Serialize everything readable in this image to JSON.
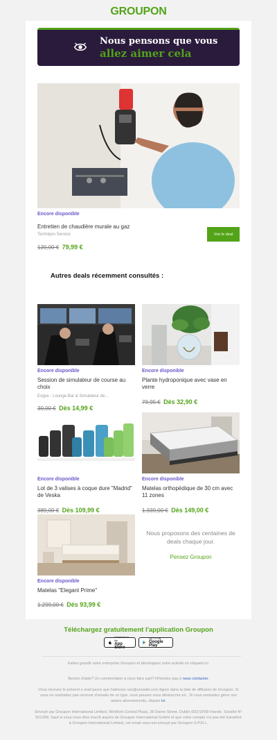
{
  "brand": {
    "logo": "GROUPON",
    "accent": "#53a318",
    "purple": "#2a1b3d",
    "available": "#6b55c9"
  },
  "hero": {
    "line1": "Nous pensons que vous",
    "line2": "allez aimer cela",
    "icon": "eye-icon"
  },
  "featured": {
    "availability": "Encore disponible",
    "title": "Entretien de chaudière murale au gaz",
    "merchant": "Technipro Service",
    "old_price": "120,00 €",
    "new_price": "79,99 €",
    "button": "Voir le deal"
  },
  "recent": {
    "title": "Autres deals récemment consultés :",
    "items": [
      {
        "availability": "Encore disponible",
        "title": "Session de simulateur de course au choix",
        "merchant": "Exype - Lounge Bar & Simulateur de...",
        "old_price": "30,00 €",
        "new_price": "Dès 14,99 €"
      },
      {
        "availability": "Encore disponible",
        "title": "Plante hydroponique avec vase en verre",
        "merchant": "",
        "old_price": "79,95 €",
        "new_price": "Dès 32,90 €"
      },
      {
        "availability": "Encore disponible",
        "title": "Lot de 3 valises à coque dure \"Madrid\" de Veska",
        "merchant": "",
        "old_price": "389,00 €",
        "new_price": "Dès 109,99 €"
      },
      {
        "availability": "Encore disponible",
        "title": "Matelas orthopédique de 30 cm avec 11 zones",
        "merchant": "",
        "old_price": "1.339,00 €",
        "new_price": "Dès 149,00 €"
      },
      {
        "availability": "Encore disponible",
        "title": "Matelas \"Elegant Prime\"",
        "merchant": "",
        "old_price": "1.299,00 €",
        "new_price": "Dès 93,99 €"
      }
    ],
    "side_text": "Nous proposons des centaines de deals chaque jour.",
    "side_link": "Pensez Groupon"
  },
  "app": {
    "title": "Téléchargez gratuitement l'application Groupon",
    "appstore_small": "Download on the",
    "appstore": "App Store",
    "play_small": "GET IT ON",
    "play": "Google Play"
  },
  "footer": {
    "grow": "Faites grandir votre entreprise Groupon et développez votre activité en cliquant ici.",
    "help_text": "Besoin d'aide? Un commentaire à nous faire part? N'hésitez pas à",
    "help_link": "nous contacter.",
    "notice": "Vous recevez le présent e-mail parce que l'adresse xxx@ureader.com figure dans la liste de diffusion de Groupon. Si vous ne souhaitez pas recevoir d'emails de ce type, vous pouvez vous désinscrire en . Si vous souhaitez gérer vos autres abonnements, cliquez",
    "notice_link": "ici.",
    "legal": "Envoyé par Groupon International Limited, WeWork Central Plaza, 36 Dame Street, Dublin D02 EF68 Irlande. Société N° 501358. Sauf si vous nous êtes inscrit auprès de Groupon International GmbH et que votre compte n'a pas été transféré à Groupon International Limited, cet email vous est envoyé par Groupon S.P.R.L."
  }
}
